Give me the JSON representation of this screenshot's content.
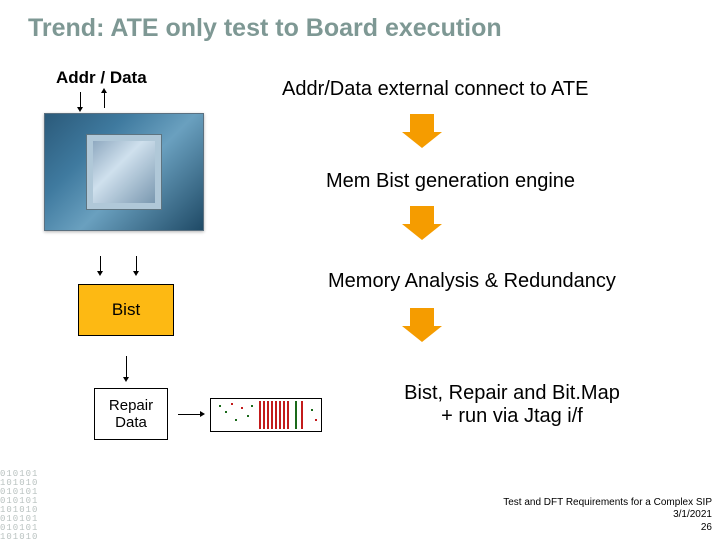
{
  "title": "Trend: ATE only test to Board execution",
  "addr_data_label": "Addr / Data",
  "bist_label": "Bist",
  "repair_label": "Repair\nData",
  "flow": {
    "step1": "Addr/Data external connect to ATE",
    "step2": "Mem Bist generation engine",
    "step3": "Memory Analysis & Redundancy",
    "step4_line1": "Bist, Repair and Bit.Map",
    "step4_line2": "+ run via Jtag i/f"
  },
  "footer": {
    "line1": "Test and DFT Requirements for a Complex SIP",
    "line2": "3/1/2021",
    "line3": "26"
  },
  "colors": {
    "title_color": "#7e9894",
    "accent_orange": "#f59c00",
    "bist_bg": "#fdb913"
  }
}
